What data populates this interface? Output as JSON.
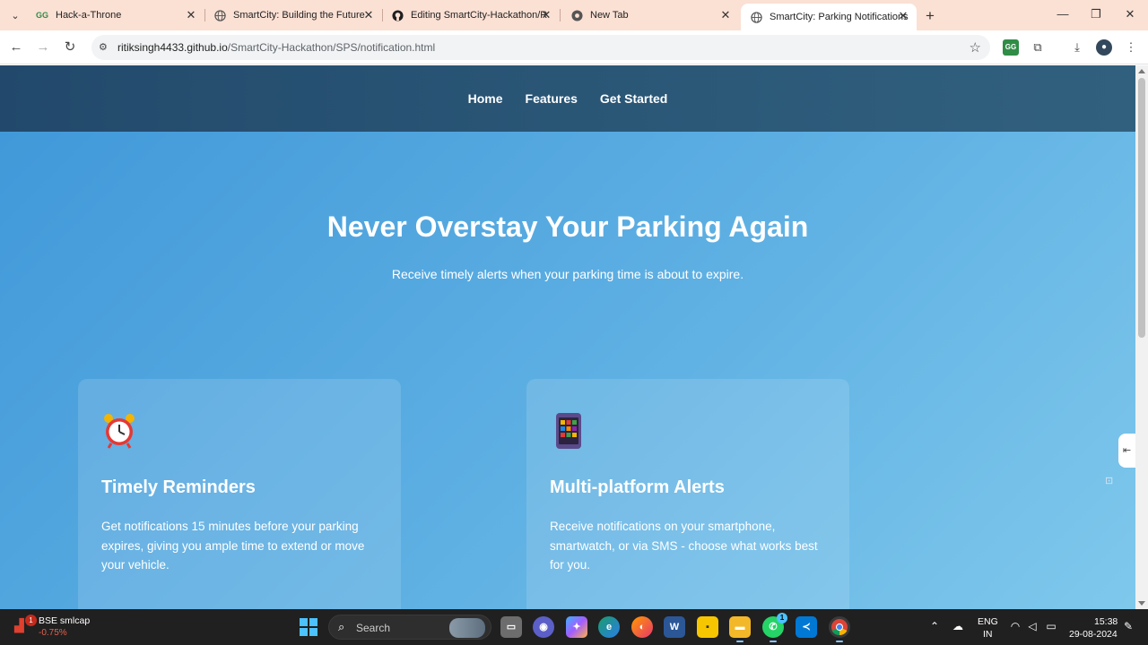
{
  "browser": {
    "tabs": [
      {
        "title": "Hack-a-Throne",
        "favicon": "geeksforgeeks-icon",
        "active": false
      },
      {
        "title": "SmartCity: Building the Future",
        "favicon": "globe-icon",
        "active": false
      },
      {
        "title": "Editing SmartCity-Hackathon/R",
        "favicon": "github-icon",
        "active": false
      },
      {
        "title": "New Tab",
        "favicon": "chrome-icon",
        "active": false
      },
      {
        "title": "SmartCity: Parking Notifications",
        "favicon": "globe-icon",
        "active": true
      }
    ],
    "url_host": "ritiksingh4433.github.io",
    "url_path": "/SmartCity-Hackathon/SPS/notification.html"
  },
  "site": {
    "nav": [
      "Home",
      "Features",
      "Get Started"
    ],
    "hero_title": "Never Overstay Your Parking Again",
    "hero_subtitle": "Receive timely alerts when your parking time is about to expire.",
    "cards": [
      {
        "icon": "alarm-clock-icon",
        "title": "Timely Reminders",
        "text": "Get notifications 15 minutes before your parking expires, giving you ample time to extend or move your vehicle."
      },
      {
        "icon": "mobile-phone-icon",
        "title": "Multi-platform Alerts",
        "text": "Receive notifications on your smartphone, smartwatch, or via SMS - choose what works best for you."
      }
    ]
  },
  "taskbar": {
    "stock_name": "BSE smlcap",
    "stock_change": "-0.75%",
    "stock_badge": "1",
    "search_placeholder": "Search",
    "whatsapp_badge": "1",
    "language": "ENG",
    "region": "IN",
    "time": "15:38",
    "date": "29-08-2024"
  },
  "colors": {
    "nav_bg": "#22496b",
    "hero_gradient_start": "#3f97d8",
    "hero_gradient_end": "#7fc8ec",
    "tabstrip_bg": "#fbe0d4"
  }
}
